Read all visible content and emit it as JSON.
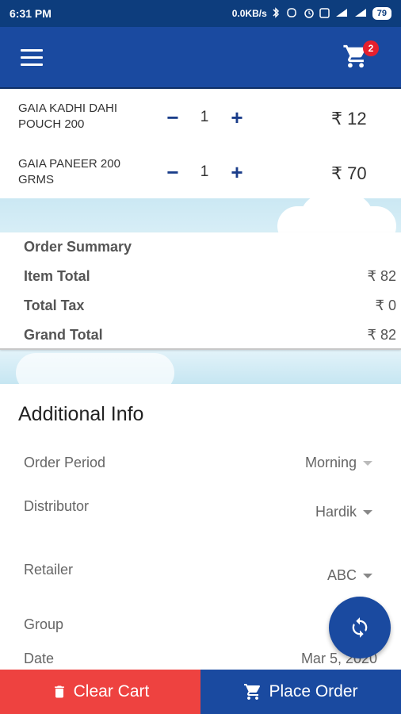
{
  "status_bar": {
    "time": "6:31 PM",
    "speed": "0.0KB/s",
    "battery": "79",
    "icons": [
      "bluetooth-icon",
      "vibrate-icon",
      "alarm-icon",
      "data-saver-icon",
      "signal-4g-icon",
      "signal-icon",
      "battery-icon"
    ]
  },
  "app_bar": {
    "menu_icon": "hamburger-menu-icon",
    "cart_icon": "shopping-cart-icon",
    "cart_count": "2",
    "primary_color": "#1a4aa0"
  },
  "cart": {
    "items": [
      {
        "name": "GAIA KADHI DAHI POUCH 200",
        "qty": "1",
        "price": "₹ 12",
        "minus": "−",
        "plus": "+"
      },
      {
        "name": "GAIA PANEER 200 GRMS",
        "qty": "1",
        "price": "₹ 70",
        "minus": "−",
        "plus": "+"
      }
    ]
  },
  "order_summary": {
    "title": "Order Summary",
    "rows": [
      {
        "label": "Item Total",
        "value": "₹ 82"
      },
      {
        "label": "Total Tax",
        "value": "₹ 0"
      },
      {
        "label": "Grand Total",
        "value": "₹ 82"
      }
    ]
  },
  "additional_info": {
    "title": "Additional Info",
    "fields": [
      {
        "label": "Order Period",
        "value": "Morning"
      },
      {
        "label": "Distributor",
        "value": "Hardik"
      },
      {
        "label": "Retailer",
        "value": "ABC"
      },
      {
        "label": "Group",
        "value": ""
      },
      {
        "label": "Date",
        "value": "Mar 5, 2020"
      }
    ]
  },
  "fab": {
    "icon": "refresh-sync-icon"
  },
  "bottom": {
    "clear_label": "Clear Cart",
    "clear_icon": "trash-icon",
    "clear_color": "#ee4240",
    "place_label": "Place Order",
    "place_icon": "shopping-cart-icon",
    "place_color": "#1a4aa0"
  }
}
